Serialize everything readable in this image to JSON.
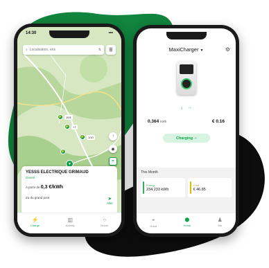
{
  "left_phone": {
    "status": {
      "time": "14:30",
      "signal": "•••"
    },
    "search": {
      "placeholder": "Localisation, ens",
      "filter_icon": "filter-icon",
      "list_icon": "list-icon"
    },
    "pins": [
      {
        "label": "10/1"
      },
      {
        "label": "+7"
      },
      {
        "label": "1/10"
      }
    ],
    "station": {
      "name": "YESSS ELECTRIQUE GRIMAUD",
      "status": "Ouvert",
      "price_prefix": "A partir de",
      "price": "0,3 €/kWh",
      "route_text": "Zu du grand pont",
      "go_label": "Aller"
    },
    "tabs": [
      {
        "label": "Charge",
        "icon": "bolt-icon"
      },
      {
        "label": "Activity",
        "icon": "activity-icon"
      },
      {
        "label": "Home",
        "icon": "home-icon"
      }
    ]
  },
  "right_phone": {
    "title": "MaxiCharger",
    "energy_value": "0.364",
    "energy_unit": "kWh",
    "cost_value": "€ 0.16",
    "charging_label": "Charging",
    "month_title": "This Month",
    "energy_card": {
      "label": "Energy",
      "value": "234.233 kWh",
      "color": "#2db35d"
    },
    "cost_card": {
      "label": "Cost",
      "value": "€ 46.85",
      "color": "#e6b800"
    },
    "tabs": [
      {
        "label": "Good",
        "icon": "pin-icon"
      },
      {
        "label": "Home",
        "icon": "home-icon"
      },
      {
        "label": "Me",
        "icon": "person-icon"
      }
    ]
  },
  "colors": {
    "brand_green": "#10a34a",
    "blob_green": "#11843d",
    "blob_black": "#0d0d0d"
  }
}
